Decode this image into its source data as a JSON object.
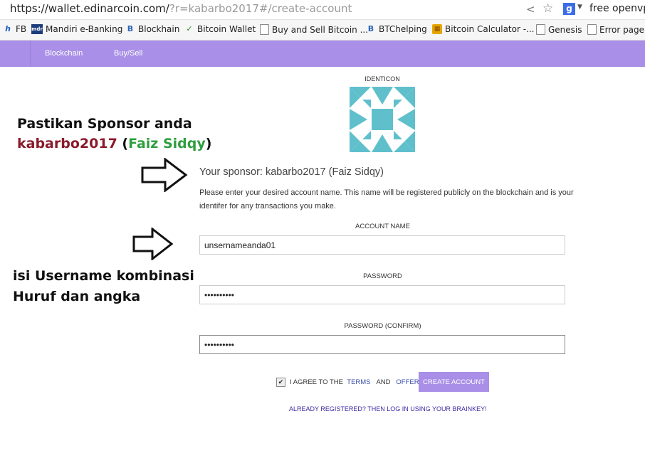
{
  "browser": {
    "url_host": "https://wallet.edinarcoin.com/",
    "url_rest": "?r=kabarbo2017#/create-account",
    "google_letter": "g",
    "search_text": "free openvp"
  },
  "bookmarks": [
    {
      "icon": "facebook-icon",
      "glyph": "h",
      "label": "FB"
    },
    {
      "icon": "mandiri-icon",
      "glyph": "mdr",
      "label": "Mandiri e-Banking"
    },
    {
      "icon": "blockchain-icon",
      "glyph": "B",
      "label": "Blockhain"
    },
    {
      "icon": "bitcoin-wallet-icon",
      "glyph": "✓",
      "label": "Bitcoin Wallet"
    },
    {
      "icon": "page-icon",
      "glyph": "",
      "label": "Buy and Sell Bitcoin ..."
    },
    {
      "icon": "blockchain-icon",
      "glyph": "B",
      "label": "BTChelping"
    },
    {
      "icon": "calculator-icon",
      "glyph": "▦",
      "label": "Bitcoin Calculator -..."
    },
    {
      "icon": "page-icon",
      "glyph": "",
      "label": "Genesis"
    },
    {
      "icon": "page-icon",
      "glyph": "",
      "label": "Error page"
    }
  ],
  "nav": {
    "items": [
      "Blockchain",
      "Buy/Sell"
    ]
  },
  "identicon": {
    "label": "IDENTICON",
    "color": "#5fc0cc"
  },
  "annotations": {
    "line1": "Pastikan Sponsor anda",
    "sponsor_user": "kabarbo2017",
    "paren_open": " (",
    "sponsor_name": "Faiz Sidqy",
    "paren_close": ")",
    "hint_line1": "isi Username kombinasi",
    "hint_line2": "Huruf dan angka"
  },
  "form": {
    "sponsor_text": "Your sponsor: kabarbo2017 (Faiz Sidqy)",
    "description": "Please enter your desired account name. This name will be registered publicly on the blockchain and is your identifer for any transactions you make.",
    "account_label": "ACCOUNT NAME",
    "account_value": "unsernameanda01",
    "password_label": "PASSWORD",
    "password_value": "••••••••••",
    "confirm_label": "PASSWORD (CONFIRM)",
    "confirm_value": "••••••••••",
    "agree_prefix": "I AGREE TO THE",
    "terms": "TERMS",
    "and": "AND",
    "offer": "OFFER",
    "checkbox_mark": "✔",
    "create_button": "CREATE ACCOUNT",
    "already_link": "ALREADY REGISTERED? THEN LOG IN USING YOUR BRAINKEY!"
  },
  "colors": {
    "nav": "#a98fe7",
    "accent_red": "#8b1a2b",
    "accent_green": "#2e9e3e",
    "link": "#3f2aa3"
  }
}
